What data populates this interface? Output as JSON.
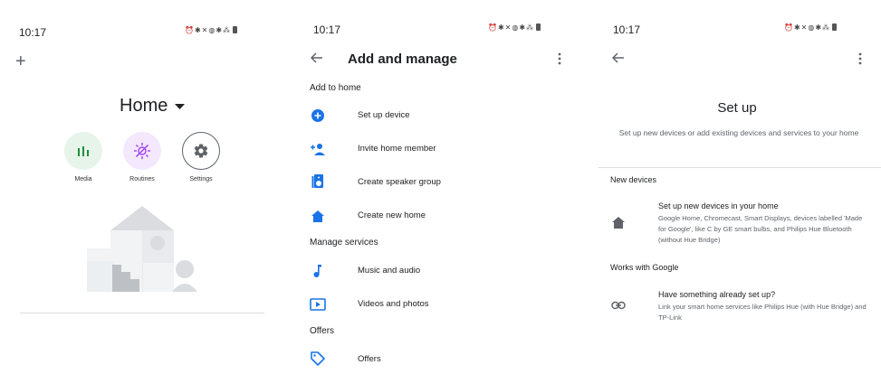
{
  "status_bar": {
    "time": "10:17",
    "icons": "⏰✱✕◍✱⁂"
  },
  "panel1": {
    "add_icon": "+",
    "home_title": "Home",
    "shortcuts": [
      {
        "label": "Media",
        "icon": "bars-icon",
        "bg": "#e6f4ea",
        "fg": "#1e8e3e"
      },
      {
        "label": "Routines",
        "icon": "sun-icon",
        "bg": "#f3e8fd",
        "fg": "#a142f4"
      },
      {
        "label": "Settings",
        "icon": "gear-icon",
        "bg": "#ffffff",
        "fg": "#5f6368"
      }
    ]
  },
  "panel2": {
    "title": "Add and manage",
    "sections": [
      {
        "heading": "Add to home"
      },
      {
        "heading": "Manage services"
      },
      {
        "heading": "Offers"
      }
    ],
    "items": [
      {
        "label": "Set up device",
        "icon": "add-circle-icon"
      },
      {
        "label": "Invite home member",
        "icon": "person-add-icon"
      },
      {
        "label": "Create speaker group",
        "icon": "speaker-icon"
      },
      {
        "label": "Create new home",
        "icon": "home-icon"
      },
      {
        "label": "Music and audio",
        "icon": "music-note-icon"
      },
      {
        "label": "Videos and photos",
        "icon": "video-icon"
      },
      {
        "label": "Offers",
        "icon": "tag-icon"
      }
    ],
    "accent": "#1a73e8"
  },
  "panel3": {
    "title": "Set up",
    "subtitle": "Set up new devices or add existing devices and services to your home",
    "new_devices_heading": "New devices",
    "new_devices_title": "Set up new devices in your home",
    "new_devices_desc": "Google Home, Chromecast, Smart Displays, devices labelled 'Made for Google', like C by GE smart bulbs, and Philips Hue Bluetooth (without Hue Bridge)",
    "works_heading": "Works with Google",
    "works_title": "Have something already set up?",
    "works_desc": "Link your smart home services like Philips Hue (with Hue Bridge) and TP-Link"
  }
}
